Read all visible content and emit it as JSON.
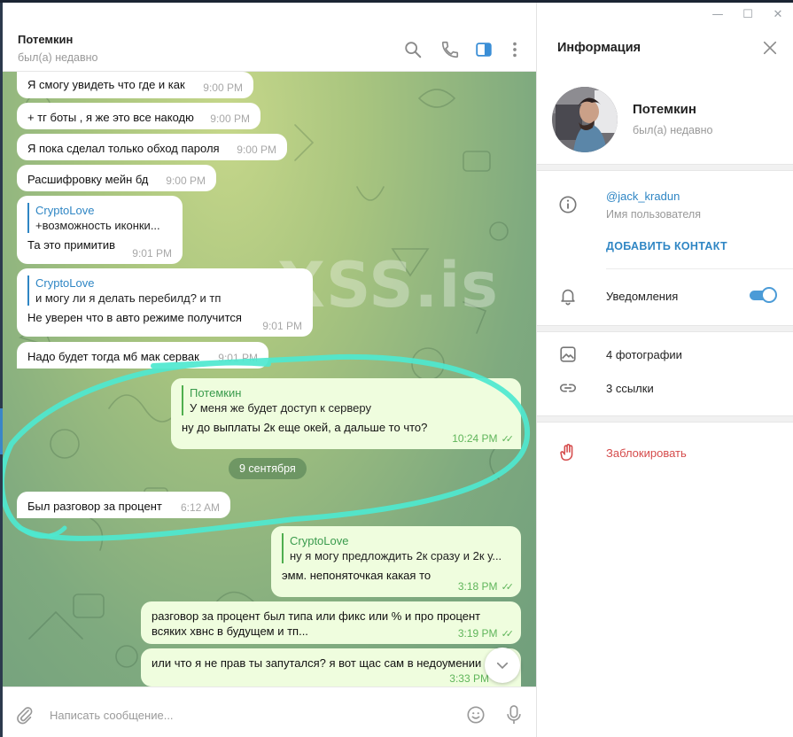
{
  "window": {
    "minimize": "—",
    "maximize": "☐",
    "close": "✕"
  },
  "chat": {
    "peer_name": "Потемкин",
    "peer_status": "был(а) недавно",
    "watermark": "XSS.is",
    "date_separator": "9 сентября",
    "composer_placeholder": "Написать сообщение...",
    "messages": [
      {
        "text": "Я смогу увидеть что где и как",
        "time": "9:00 PM"
      },
      {
        "text": "+ тг боты , я же это все накодю",
        "time": "9:00 PM"
      },
      {
        "text": "Я пока сделал только обход пароля",
        "time": "9:00 PM"
      },
      {
        "text": "Расшифровку мейн бд",
        "time": "9:00 PM"
      },
      {
        "reply_name": "CryptoLove",
        "reply_text": "+возможность иконки...",
        "text": "Та это примитив",
        "time": "9:01 PM"
      },
      {
        "reply_name": "CryptoLove",
        "reply_text": "и могу ли я делать перебилд? и тп",
        "text": "Не уверен что в авто режиме получится",
        "time": "9:01 PM"
      },
      {
        "text": "Надо будет тогда мб мак сервак",
        "time": "9:01 PM"
      },
      {
        "reply_name": "Потемкин",
        "reply_text": "У меня же будет доступ к серверу",
        "text": "ну до выплаты 2к еще окей, а дальше то что?",
        "time": "10:24 PM"
      },
      {
        "text": "Был разговор за процент",
        "time": "6:12 AM"
      },
      {
        "reply_name": "CryptoLove",
        "reply_text": "ну я могу предлождить 2к сразу и 2к у...",
        "text": "эмм. непоняточкая какая то",
        "time": "3:18 PM"
      },
      {
        "text": "разговор за процент был типа или фикс или % и про процент",
        "text2": "всяких хвнс в будущем и тп...",
        "time": "3:19 PM"
      },
      {
        "text": "или что я не прав ты запутался? я вот щас сам в недоумении",
        "time": "3:33 PM"
      }
    ]
  },
  "info": {
    "title": "Информация",
    "name": "Потемкин",
    "status": "был(а) недавно",
    "username": "@jack_kradun",
    "username_caption": "Имя пользователя",
    "add_contact": "ДОБАВИТЬ КОНТАКТ",
    "notifications": "Уведомления",
    "notifications_on": true,
    "photos": "4 фотографии",
    "links": "3 ссылки",
    "block": "Заблокировать"
  },
  "colors": {
    "accent": "#2f86c4",
    "outgoing_bubble": "#effdde",
    "incoming_bubble": "#ffffff",
    "read_ticks": "#5fb55a",
    "danger": "#d54b4b",
    "annotation": "#4ee8cf"
  }
}
